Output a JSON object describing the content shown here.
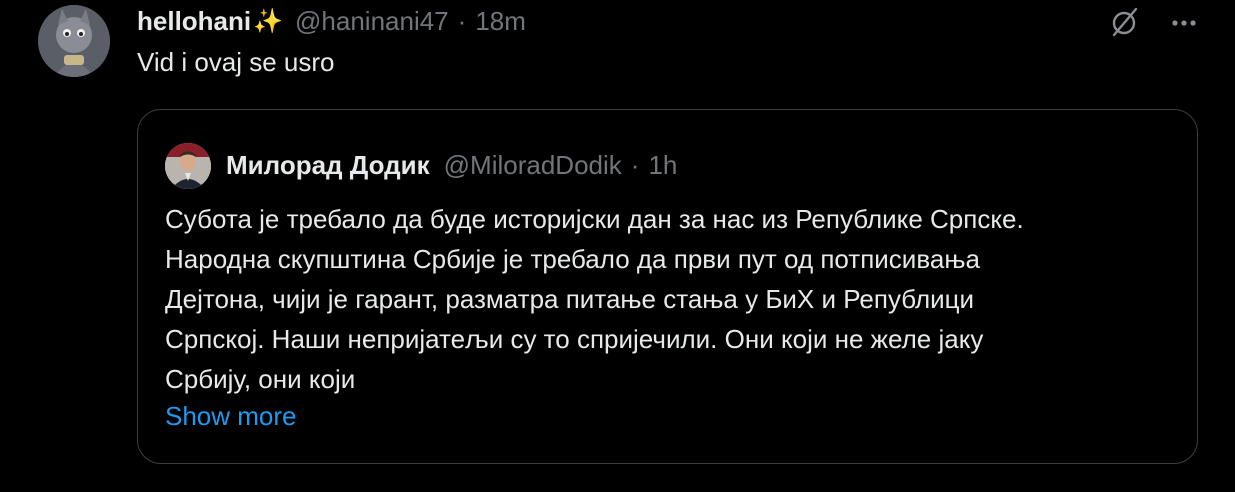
{
  "tweet": {
    "display_name": "hellohani",
    "sparkle": "✨",
    "handle": "@haninani47",
    "separator": "·",
    "time": "18m",
    "text": "Vid i ovaj se usro"
  },
  "quote": {
    "display_name": "Милорад Додик",
    "handle": "@MiloradDodik",
    "separator": "·",
    "time": "1h",
    "lines": [
      "Субота је требало да буде историјски дан за нас из Републике Српске.",
      "Народна скупштина Србије је требало да први пут од потписивања",
      "Дејтона, чији је гарант, разматра питање стања у БиХ и Републици",
      "Српској. Наши непријатељи су то спријечили. Они који не желе јаку",
      "Србију, они који"
    ],
    "show_more": "Show more"
  },
  "icons": {
    "grok": "grok-icon",
    "more": "more-horizontal-icon"
  },
  "colors": {
    "background": "#000000",
    "text": "#e7e9ea",
    "secondary": "#71767b",
    "link": "#1d9bf0",
    "border": "#3b3e42"
  }
}
